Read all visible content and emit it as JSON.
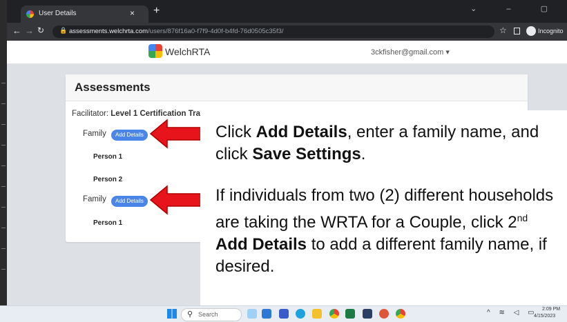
{
  "browser": {
    "tab_title": "User Details",
    "tab_close": "×",
    "new_tab": "+",
    "window_controls": "⌄ – ▢",
    "url_domain": "assessments.welchrta.com",
    "url_path": "/users/876f16a0-f7f9-4d0f-b4fd-76d0505c35f3/",
    "incognito_label": "Incognito"
  },
  "topnav": {
    "brand": "WelchRTA",
    "user_email": "3ckfisher@gmail.com ▾"
  },
  "card": {
    "title": "Assessments",
    "facilitator_prefix": "Facilitator: ",
    "facilitator_name": "Level 1 Certification Tra",
    "families": [
      {
        "label": "Family",
        "button": "Add Details",
        "persons": [
          "Person 1",
          "Person 2"
        ]
      },
      {
        "label": "Family",
        "button": "Add Details",
        "persons": [
          "Person 1"
        ]
      }
    ]
  },
  "annotation": {
    "para1": {
      "t1": "Click ",
      "b1": "Add Details",
      "t2": ", enter a family name, and click ",
      "b2": "Save Settings",
      "t3": "."
    },
    "para2": {
      "t1": "If individuals from two (2) different households are taking the WRTA for a Couple, click 2",
      "sup": "nd",
      "t2": " ",
      "b1": "Add Details",
      "t3": " to add a different family name, if desired."
    },
    "arrow_color": "#e8141b"
  },
  "taskbar": {
    "search_label": "Search",
    "time": "2:09 PM",
    "date": "4/15/2023"
  }
}
